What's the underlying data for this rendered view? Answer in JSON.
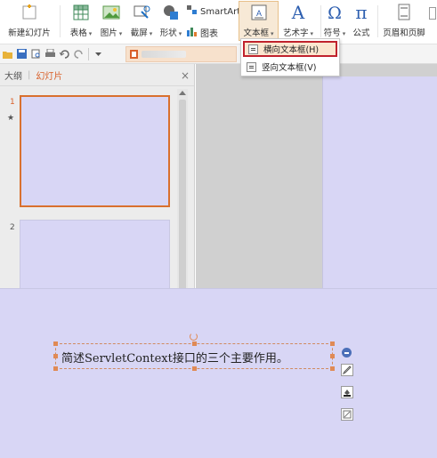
{
  "ribbon": {
    "new_slide": "新建幻灯片",
    "table": "表格",
    "picture": "图片",
    "screenshot": "截屏",
    "shape": "形状",
    "smartart": "SmartArt",
    "chart": "图表",
    "textbox": "文本框",
    "wordart": "艺术字",
    "symbol": "符号",
    "formula": "公式",
    "header_footer": "页眉和页脚"
  },
  "dropdown_arrow": "▾",
  "panel": {
    "tab_outline": "大纲",
    "tab_divider": "|",
    "tab_slides": "幻灯片",
    "close": "×",
    "slide1_num": "1",
    "slide2_num": "2",
    "star": "★"
  },
  "menu": {
    "horizontal": "横向文本框(H)",
    "vertical": "竖向文本框(V)"
  },
  "slide": {
    "text": "简述ServletContext接口的三个主要作用。"
  },
  "colors": {
    "accent": "#d9702e",
    "slide_bg": "#d8d6f5",
    "highlight_border": "#c0222d"
  },
  "icons": [
    "new-slide-icon",
    "table-icon",
    "picture-icon",
    "screenshot-icon",
    "shape-icon",
    "smartart-icon",
    "chart-icon",
    "textbox-icon",
    "wordart-icon",
    "symbol-icon",
    "formula-icon",
    "header-footer-icon"
  ]
}
